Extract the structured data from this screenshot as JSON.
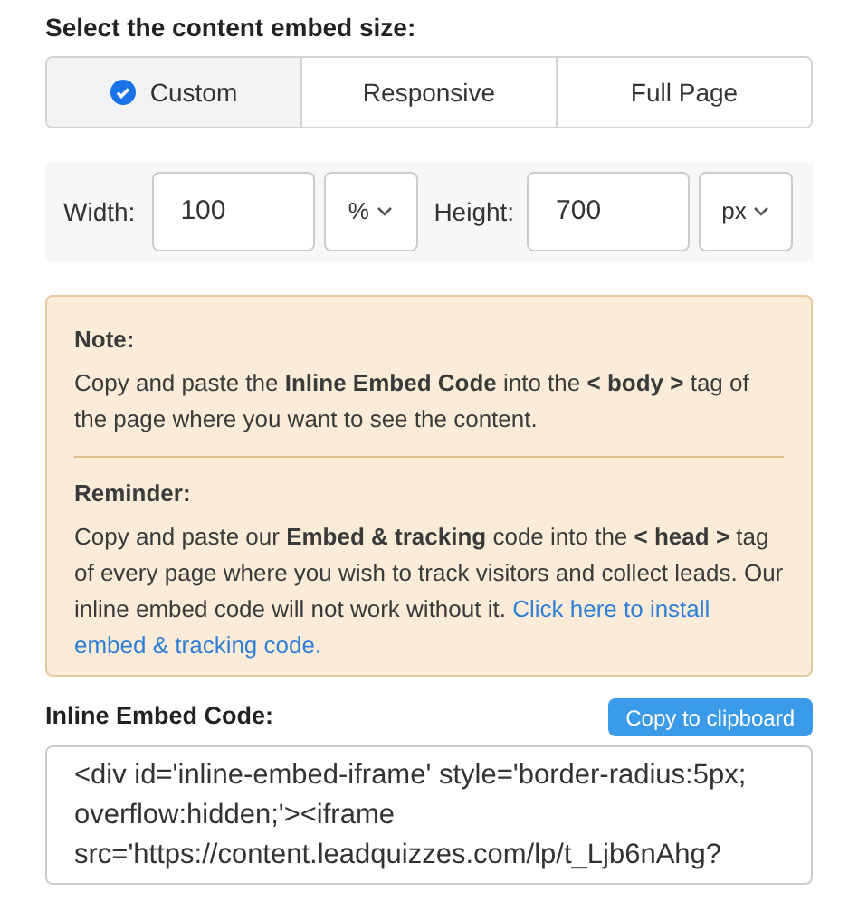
{
  "size_heading": "Select the content embed size:",
  "size_tabs": [
    {
      "label": "Custom",
      "selected": true
    },
    {
      "label": "Responsive",
      "selected": false
    },
    {
      "label": "Full Page",
      "selected": false
    }
  ],
  "dimensions": {
    "width_label": "Width:",
    "width_value": "100",
    "width_unit": "%",
    "height_label": "Height:",
    "height_value": "700",
    "height_unit": "px"
  },
  "note": {
    "title": "Note:",
    "text": "Copy and paste the **Inline Embed Code** into the **< body >** tag of the page where you want to see the content."
  },
  "reminder": {
    "title": "Reminder:",
    "text": "Copy and paste our **Embed & tracking** code into the **< head >** tag of every page where you wish to track visitors and collect leads. Our inline embed code will not work without it.",
    "links": [
      "Click here to install",
      "embed & tracking code."
    ]
  },
  "embed_code": {
    "label": "Inline Embed Code:",
    "copy_button": "Copy to clipboard",
    "lines": [
      "<div id='inline-embed-iframe' style='border-radius:5px;",
      "overflow:hidden;'><iframe",
      "src='https://content.leadquizzes.com/lp/t_Ljb6nAhg?"
    ]
  }
}
